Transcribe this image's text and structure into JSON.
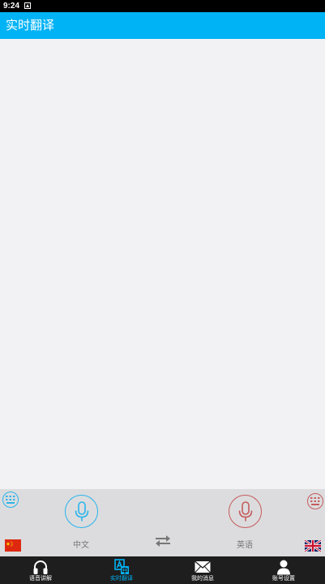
{
  "status_bar": {
    "time": "9:24"
  },
  "header": {
    "title": "实时翻译"
  },
  "colors": {
    "accent": "#00b3f5",
    "source_ring": "#29b4ec",
    "target_ring": "#c45b5b",
    "tab_bar": "#1e1e1e"
  },
  "translator": {
    "source_language": "中文",
    "target_language": "英语",
    "source_flag_icon": "china-flag-icon",
    "target_flag_icon": "uk-flag-icon"
  },
  "tabs": [
    {
      "label": "语音讲解",
      "icon": "headphones-icon"
    },
    {
      "label": "实时翻译",
      "icon": "translate-icon",
      "active": true
    },
    {
      "label": "我的消息",
      "icon": "envelope-icon"
    },
    {
      "label": "账号设置",
      "icon": "person-icon"
    }
  ]
}
